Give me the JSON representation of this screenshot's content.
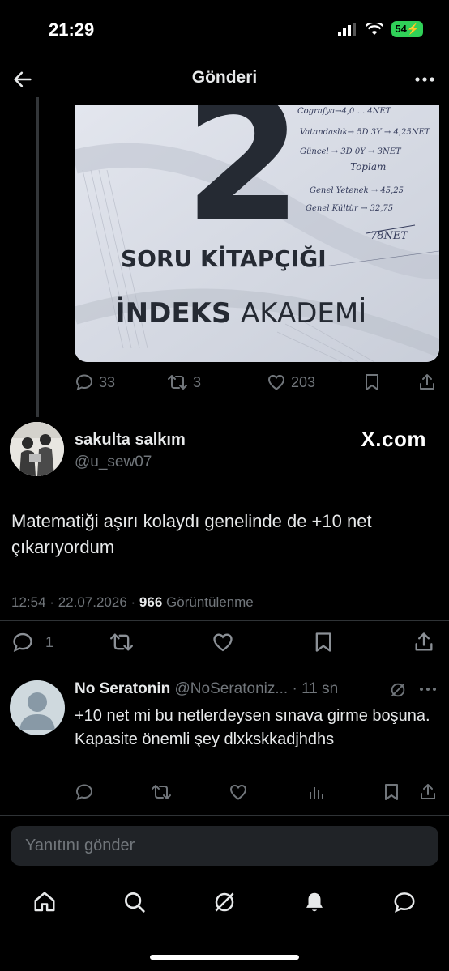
{
  "status_bar": {
    "time": "21:29",
    "battery": "54"
  },
  "header": {
    "title": "Gönderi"
  },
  "quoted_post": {
    "image_text": {
      "big_number": "2",
      "soru": "SORU KİTAPÇIĞI",
      "brand_bold": "İNDEKS",
      "brand_light": "AKADEMİ",
      "notes": [
        "Cografya→4,0 ... 4NET",
        "Vatandaslık→ 5D 3Y → 4,25NET",
        "Güncel → 3D 0Y → 3NET",
        "Toplam",
        "Genel Yetenek → 45,25",
        "Genel Kültür → 32,75",
        "78NET"
      ]
    },
    "actions": {
      "replies": "33",
      "reposts": "3",
      "likes": "203"
    }
  },
  "main_post": {
    "author_name": "sakulta salkım",
    "author_handle": "@u_sew07",
    "watermark": "X.com",
    "text": "Matematiği aşırı kolaydı genelinde de +10 net çıkarıyordum",
    "time": "12:54",
    "date": "22.07.2026",
    "views": "966",
    "views_label": "Görüntülenme",
    "replies": "1"
  },
  "reply": {
    "name": "No Seratonin",
    "handle": "@NoSeratoniz...",
    "time": "11 sn",
    "text": "+10 net mi bu netlerdeysen sınava girme boşuna. Kapasite önemli şey dlxkskkadjhdhs"
  },
  "composer": {
    "placeholder": "Yanıtını gönder"
  },
  "tabbar": {
    "items": [
      "home-icon",
      "search-icon",
      "grok-icon",
      "notifications-icon",
      "messages-icon"
    ]
  }
}
